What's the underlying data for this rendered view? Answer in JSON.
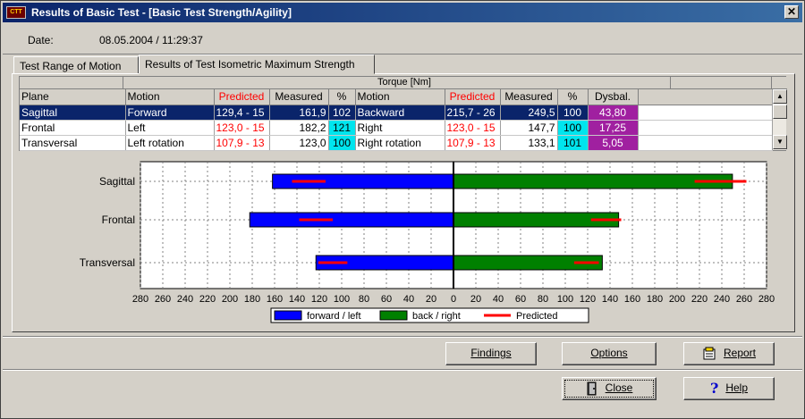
{
  "window": {
    "title": "Results of Basic Test - [Basic Test Strength/Agility]",
    "close_glyph": "✕"
  },
  "header": {
    "date_label": "Date:",
    "date_value": "08.05.2004    / 11:29:37"
  },
  "tabs": [
    {
      "label": "Test Range of Motion",
      "active": false
    },
    {
      "label": "Results of Test Isometric Maximum Strength",
      "active": true
    }
  ],
  "table": {
    "group_header": "Torque [Nm]",
    "columns": [
      "Plane",
      "Motion",
      "Predicted",
      "Measured",
      "%",
      "Motion",
      "Predicted",
      "Measured",
      "%",
      "Dysbal."
    ],
    "rows": [
      {
        "plane": "Sagittal",
        "motion1": "Forward",
        "pred1": "129,4 - 15",
        "meas1": "161,9",
        "pct1": "102",
        "motion2": "Backward",
        "pred2": "215,7 - 26",
        "meas2": "249,5",
        "pct2": "100",
        "dysbal": "43,80",
        "selected": true
      },
      {
        "plane": "Frontal",
        "motion1": "Left",
        "pred1": "123,0 - 15",
        "meas1": "182,2",
        "pct1": "121",
        "motion2": "Right",
        "pred2": "123,0 - 15",
        "meas2": "147,7",
        "pct2": "100",
        "dysbal": "17,25",
        "selected": false
      },
      {
        "plane": "Transversal",
        "motion1": "Left rotation",
        "pred1": "107,9 - 13",
        "meas1": "123,0",
        "pct1": "100",
        "motion2": "Right rotation",
        "pred2": "107,9 - 13",
        "meas2": "133,1",
        "pct2": "101",
        "dysbal": "5,05",
        "selected": false
      }
    ]
  },
  "chart_data": {
    "type": "bar",
    "orientation": "horizontal",
    "categories": [
      "Sagittal",
      "Frontal",
      "Transversal"
    ],
    "xlim": [
      -280,
      280
    ],
    "x_ticks": [
      "280",
      "260",
      "240",
      "220",
      "200",
      "180",
      "160",
      "140",
      "120",
      "100",
      "80",
      "60",
      "40",
      "20",
      "0",
      "20",
      "40",
      "60",
      "80",
      "100",
      "120",
      "140",
      "160",
      "180",
      "200",
      "220",
      "240",
      "260",
      "280"
    ],
    "grid": true,
    "series": [
      {
        "name": "forward / left",
        "color": "#0000ff",
        "values": [
          161.9,
          182.2,
          123.0
        ]
      },
      {
        "name": "back / right",
        "color": "#008000",
        "values": [
          249.5,
          147.7,
          133.1
        ]
      },
      {
        "name": "Predicted",
        "color": "#ff0000",
        "left_ranges": [
          [
            114.4,
            144.4
          ],
          [
            108.0,
            138.0
          ],
          [
            94.9,
            120.9
          ]
        ],
        "right_ranges": [
          [
            215.7,
            262.0
          ],
          [
            123.0,
            150.0
          ],
          [
            107.9,
            130.0
          ]
        ]
      }
    ],
    "legend_position": "bottom"
  },
  "buttons": {
    "findings": "Findings",
    "options": "Options",
    "report": "Report",
    "close": "Close",
    "help": "Help"
  }
}
